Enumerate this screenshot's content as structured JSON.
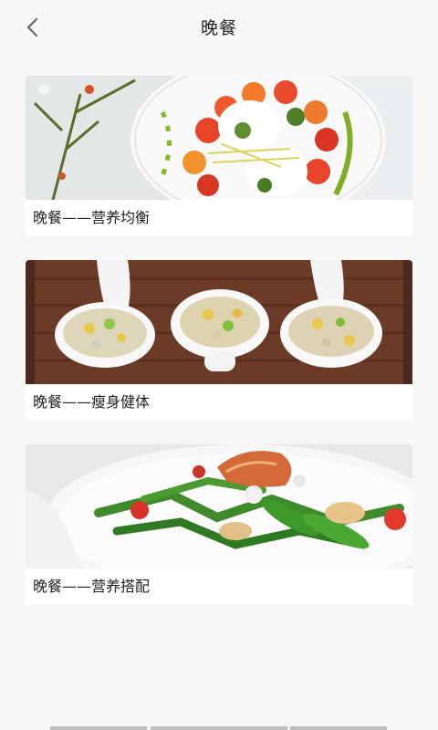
{
  "header": {
    "title": "晚餐",
    "back_icon": "chevron-left-icon"
  },
  "cards": [
    {
      "label": "晚餐——营养均衡",
      "image": "caprese-plate-photo"
    },
    {
      "label": "晚餐——瘦身健体",
      "image": "spoon-salads-photo"
    },
    {
      "label": "晚餐——营养搭配",
      "image": "green-salad-photo"
    }
  ],
  "colors": {
    "background": "#f7f7f7",
    "card": "#ffffff",
    "text": "#222222"
  }
}
